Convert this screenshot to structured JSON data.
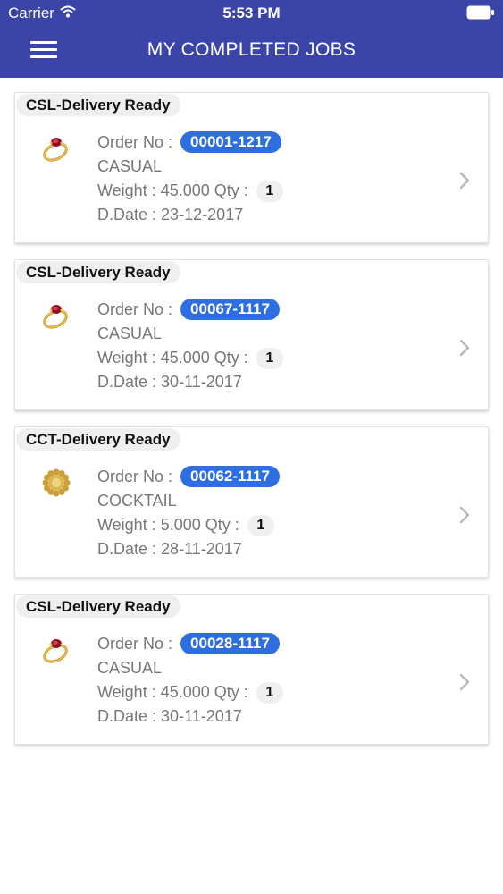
{
  "status_bar": {
    "carrier": "Carrier",
    "time": "5:53 PM"
  },
  "header": {
    "title": "MY COMPLETED JOBS",
    "menu_icon": "hamburger-menu-icon",
    "background": "#3b45a8"
  },
  "labels": {
    "order_no": "Order No :",
    "weight": "Weight :",
    "qty": "Qty :",
    "date": "D.Date :"
  },
  "colors": {
    "order_badge": "#2d6fe0",
    "chip": "#efefef"
  },
  "jobs": [
    {
      "status": "CSL-Delivery Ready",
      "order_no": "00001-1217",
      "category": "CASUAL",
      "weight": "45.000",
      "qty": "1",
      "date": "23-12-2017",
      "thumbnail_icon": "ruby-ring-icon"
    },
    {
      "status": "CSL-Delivery Ready",
      "order_no": "00067-1117",
      "category": "CASUAL",
      "weight": "45.000",
      "qty": "1",
      "date": "30-11-2017",
      "thumbnail_icon": "ruby-ring-icon"
    },
    {
      "status": "CCT-Delivery Ready",
      "order_no": "00062-1117",
      "category": "COCKTAIL",
      "weight": "5.000",
      "qty": "1",
      "date": "28-11-2017",
      "thumbnail_icon": "cocktail-ring-icon"
    },
    {
      "status": "CSL-Delivery Ready",
      "order_no": "00028-1117",
      "category": "CASUAL",
      "weight": "45.000",
      "qty": "1",
      "date": "30-11-2017",
      "thumbnail_icon": "ruby-ring-icon"
    }
  ]
}
